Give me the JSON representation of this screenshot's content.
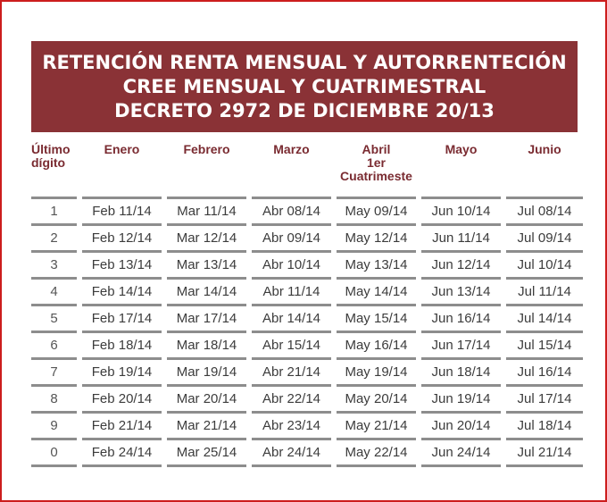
{
  "title": {
    "line1": "RETENCIÓN RENTA MENSUAL Y AUTORRENTECIÓN",
    "line2": "CREE MENSUAL Y CUATRIMESTRAL",
    "line3": "DECRETO 2972 DE DICIEMBRE 20/13"
  },
  "table": {
    "header": {
      "digit_line1": "Último",
      "digit_line2": "dígito",
      "enero": "Enero",
      "febrero": "Febrero",
      "marzo": "Marzo",
      "abril_line1": "Abril",
      "abril_line2": "1er",
      "abril_line3": "Cuatrimeste",
      "mayo": "Mayo",
      "junio": "Junio"
    },
    "rows": [
      {
        "digit": "1",
        "enero": "Feb 11/14",
        "febrero": "Mar 11/14",
        "marzo": "Abr 08/14",
        "abril": "May 09/14",
        "mayo": "Jun 10/14",
        "junio": "Jul 08/14"
      },
      {
        "digit": "2",
        "enero": "Feb 12/14",
        "febrero": "Mar 12/14",
        "marzo": "Abr 09/14",
        "abril": "May 12/14",
        "mayo": "Jun 11/14",
        "junio": "Jul 09/14"
      },
      {
        "digit": "3",
        "enero": "Feb 13/14",
        "febrero": "Mar 13/14",
        "marzo": "Abr 10/14",
        "abril": "May 13/14",
        "mayo": "Jun 12/14",
        "junio": "Jul 10/14"
      },
      {
        "digit": "4",
        "enero": "Feb 14/14",
        "febrero": "Mar 14/14",
        "marzo": "Abr 11/14",
        "abril": "May 14/14",
        "mayo": "Jun 13/14",
        "junio": "Jul 11/14"
      },
      {
        "digit": "5",
        "enero": "Feb 17/14",
        "febrero": "Mar 17/14",
        "marzo": "Abr 14/14",
        "abril": "May 15/14",
        "mayo": "Jun 16/14",
        "junio": "Jul 14/14"
      },
      {
        "digit": "6",
        "enero": "Feb 18/14",
        "febrero": "Mar 18/14",
        "marzo": "Abr 15/14",
        "abril": "May 16/14",
        "mayo": "Jun 17/14",
        "junio": "Jul 15/14"
      },
      {
        "digit": "7",
        "enero": "Feb 19/14",
        "febrero": "Mar 19/14",
        "marzo": "Abr 21/14",
        "abril": "May 19/14",
        "mayo": "Jun 18/14",
        "junio": "Jul 16/14"
      },
      {
        "digit": "8",
        "enero": "Feb 20/14",
        "febrero": "Mar 20/14",
        "marzo": "Abr 22/14",
        "abril": "May 20/14",
        "mayo": "Jun 19/14",
        "junio": "Jul 17/14"
      },
      {
        "digit": "9",
        "enero": "Feb 21/14",
        "febrero": "Mar 21/14",
        "marzo": "Abr 23/14",
        "abril": "May 21/14",
        "mayo": "Jun 20/14",
        "junio": "Jul 18/14"
      },
      {
        "digit": "0",
        "enero": "Feb 24/14",
        "febrero": "Mar 25/14",
        "marzo": "Abr 24/14",
        "abril": "May 22/14",
        "mayo": "Jun 24/14",
        "junio": "Jul 21/14"
      }
    ]
  },
  "colors": {
    "banner": "#8a3236",
    "header_text": "#7a2b31",
    "frame_border": "#cc1d1d",
    "rule": "#8d8d8d"
  }
}
